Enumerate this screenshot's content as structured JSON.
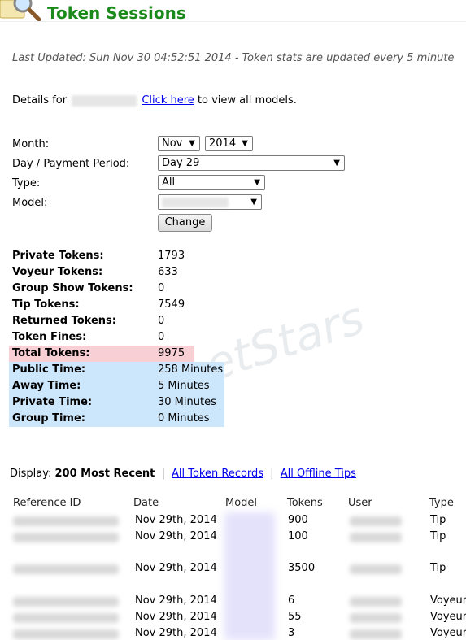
{
  "header": {
    "title": "Token Sessions",
    "icon": "magnifier-icon"
  },
  "last_updated": "Last Updated: Sun Nov 30 04:52:51 2014 - Token stats are updated every 5 minute",
  "details": {
    "prefix": "Details for",
    "link": "Click here",
    "suffix": "to view all models."
  },
  "form": {
    "month_label": "Month:",
    "month_value": "Nov",
    "year_value": "2014",
    "day_label": "Day / Payment Period:",
    "day_value": "Day 29",
    "type_label": "Type:",
    "type_value": "All",
    "model_label": "Model:",
    "change_button": "Change"
  },
  "stats": [
    {
      "label": "Private Tokens:",
      "value": "1793"
    },
    {
      "label": "Voyeur Tokens:",
      "value": "633"
    },
    {
      "label": "Group Show Tokens:",
      "value": "0"
    },
    {
      "label": "Tip Tokens:",
      "value": "7549"
    },
    {
      "label": "Returned Tokens:",
      "value": "0"
    },
    {
      "label": "Token Fines:",
      "value": "0"
    },
    {
      "label": "Total Tokens:",
      "value": "9975"
    },
    {
      "label": "Public Time:",
      "value": "258 Minutes"
    },
    {
      "label": "Away Time:",
      "value": "5 Minutes"
    },
    {
      "label": "Private Time:",
      "value": "30 Minutes"
    },
    {
      "label": "Group Time:",
      "value": "0 Minutes"
    }
  ],
  "colors": {
    "title": "#1a8a1a",
    "total_highlight": "#f9cfd6",
    "time_highlight": "#cce6fb",
    "link": "#0000ee"
  },
  "watermark": "etStars",
  "display": {
    "label": "Display:",
    "current": "200 Most Recent",
    "link1": "All Token Records",
    "link2": "All Offline Tips"
  },
  "table": {
    "headers": [
      "Reference ID",
      "Date",
      "Model",
      "Tokens",
      "User",
      "Type"
    ],
    "rows": [
      {
        "date": "Nov 29th, 2014",
        "tokens": "900",
        "type": "Tip"
      },
      {
        "date": "Nov 29th, 2014",
        "tokens": "100",
        "type": "Tip"
      },
      {
        "date": "Nov 29th, 2014",
        "tokens": "3500",
        "type": "Tip"
      },
      {
        "date": "Nov 29th, 2014",
        "tokens": "6",
        "type": "Voyeur"
      },
      {
        "date": "Nov 29th, 2014",
        "tokens": "55",
        "type": "Voyeur"
      },
      {
        "date": "Nov 29th, 2014",
        "tokens": "3",
        "type": "Voyeur"
      }
    ]
  }
}
